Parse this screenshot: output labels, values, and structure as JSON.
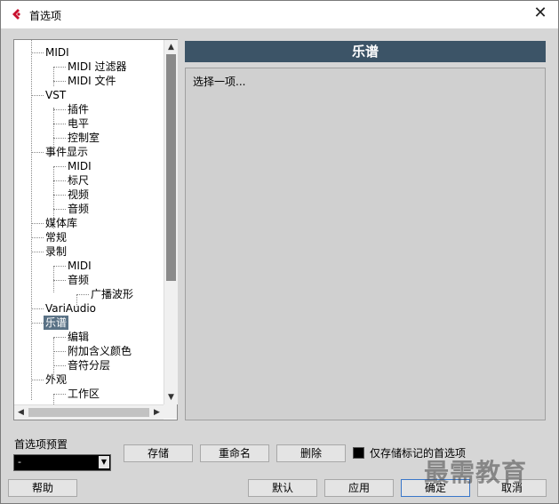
{
  "window": {
    "title": "首选项"
  },
  "tree": {
    "items": [
      {
        "label": "MIDI"
      },
      {
        "label": "MIDI 过滤器"
      },
      {
        "label": "MIDI 文件"
      },
      {
        "label": "VST"
      },
      {
        "label": "插件"
      },
      {
        "label": "电平"
      },
      {
        "label": "控制室"
      },
      {
        "label": "事件显示"
      },
      {
        "label": "MIDI"
      },
      {
        "label": "标尺"
      },
      {
        "label": "视频"
      },
      {
        "label": "音频"
      },
      {
        "label": "媒体库"
      },
      {
        "label": "常规"
      },
      {
        "label": "录制"
      },
      {
        "label": "MIDI"
      },
      {
        "label": "音频"
      },
      {
        "label": "广播波形"
      },
      {
        "label": "VariAudio"
      },
      {
        "label": "乐谱",
        "selected": true
      },
      {
        "label": "编辑"
      },
      {
        "label": "附加含义颜色"
      },
      {
        "label": "音符分层"
      },
      {
        "label": "外观"
      },
      {
        "label": "工作区"
      }
    ]
  },
  "panel": {
    "title": "乐谱",
    "hint": "选择一项..."
  },
  "presets": {
    "label": "首选项预置",
    "current_value": "-",
    "store_label": "存储",
    "rename_label": "重命名",
    "delete_label": "删除",
    "store_marked_only_label": "仅存储标记的首选项"
  },
  "footer": {
    "help_label": "帮助",
    "default_label": "默认",
    "apply_label": "应用",
    "ok_label": "确定",
    "cancel_label": "取消"
  },
  "watermark": "最需教育",
  "icons": {
    "close": "close-icon",
    "app": "cubase-logo-icon",
    "scroll_up": "scroll-up-arrow-icon",
    "scroll_down": "scroll-down-arrow-icon",
    "scroll_left": "scroll-left-arrow-icon",
    "scroll_right": "scroll-right-arrow-icon",
    "dropdown": "chevron-down-icon"
  },
  "colors": {
    "panel_header_bg": "#3c5467",
    "selection_bg": "#5a7286",
    "dialog_bg": "#d6d6d6",
    "ok_border": "#3a77c9"
  }
}
